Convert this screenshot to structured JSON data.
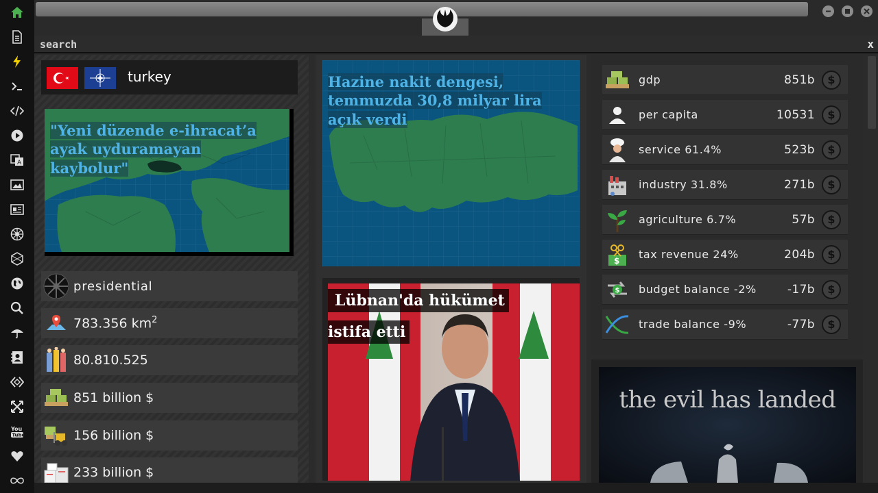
{
  "search": {
    "label": "search",
    "close": "x"
  },
  "country": {
    "name": "turkey",
    "flags": [
      "turkey-flag",
      "nato-flag"
    ]
  },
  "headlines": {
    "left_map": "\"Yeni düzende e-ihracat’a ayak uyduramayan kaybolur\"",
    "center_map": "Hazine nakit dengesi, temmuzda 30,8 milyar lira açık verdi",
    "news_line1": "Lübnan'da hükümet",
    "news_line2": "istifa etti"
  },
  "stats": [
    {
      "icon": "government-icon",
      "text": "presidential"
    },
    {
      "icon": "area-icon",
      "text": "783.356 km",
      "sup": "2"
    },
    {
      "icon": "population-icon",
      "text": "80.810.525"
    },
    {
      "icon": "money-icon",
      "text": "851 billion $"
    },
    {
      "icon": "forklift-icon",
      "text": "156 billion $"
    },
    {
      "icon": "boxes-icon",
      "text": "233 billion $"
    }
  ],
  "economy": [
    {
      "icon": "gdp-icon",
      "label": "gdp",
      "value": "851b"
    },
    {
      "icon": "person-icon",
      "label": "per capita",
      "value": "10531"
    },
    {
      "icon": "chef-icon",
      "label": "service 61.4%",
      "value": "523b"
    },
    {
      "icon": "factory-icon",
      "label": "industry 31.8%",
      "value": "271b"
    },
    {
      "icon": "plant-icon",
      "label": "agriculture 6.7%",
      "value": "57b"
    },
    {
      "icon": "tax-icon",
      "label": "tax revenue 24%",
      "value": "204b"
    },
    {
      "icon": "budget-icon",
      "label": "budget balance -2%",
      "value": "-17b"
    },
    {
      "icon": "trade-icon",
      "label": "trade balance -9%",
      "value": "-77b"
    }
  ],
  "currency_symbol": "$",
  "promo": {
    "text": "the evil has landed"
  },
  "colors": {
    "accent_green": "#4caf50",
    "map_blue": "#0a5580",
    "land_green": "#2e7d4f",
    "headline_blue": "#4fb3e6"
  }
}
